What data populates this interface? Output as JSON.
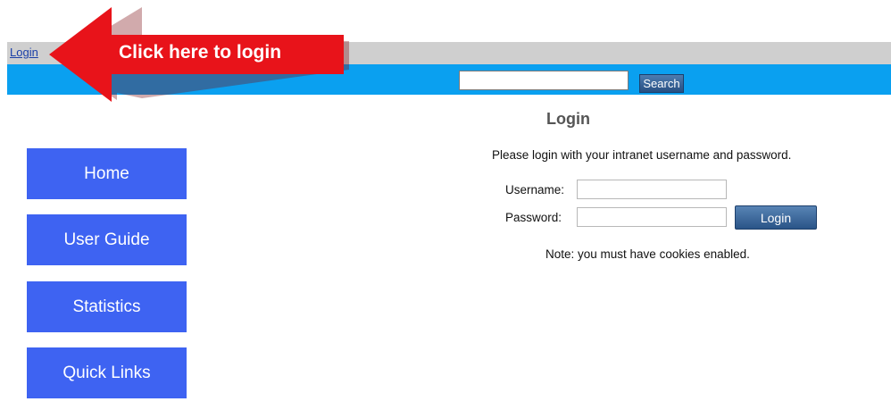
{
  "header": {
    "login_link": "Login"
  },
  "search": {
    "placeholder": "",
    "button_label": "Search"
  },
  "sidebar": {
    "items": [
      {
        "label": "Home"
      },
      {
        "label": "User Guide"
      },
      {
        "label": "Statistics"
      },
      {
        "label": "Quick Links"
      }
    ]
  },
  "login_form": {
    "title": "Login",
    "intro": "Please login with your intranet username and password.",
    "username_label": "Username:",
    "password_label": "Password:",
    "username_value": "",
    "password_value": "",
    "submit_label": "Login",
    "note": "Note: you must have cookies enabled."
  },
  "annotation": {
    "text": "Click here to login",
    "icon": "left-arrow-callout-icon",
    "color": "#e8131a"
  },
  "colors": {
    "top_bar": "#cfcfcf",
    "blue_bar": "#0aa0f0",
    "nav_button": "#3e63f2",
    "action_button": "#2a5487"
  }
}
